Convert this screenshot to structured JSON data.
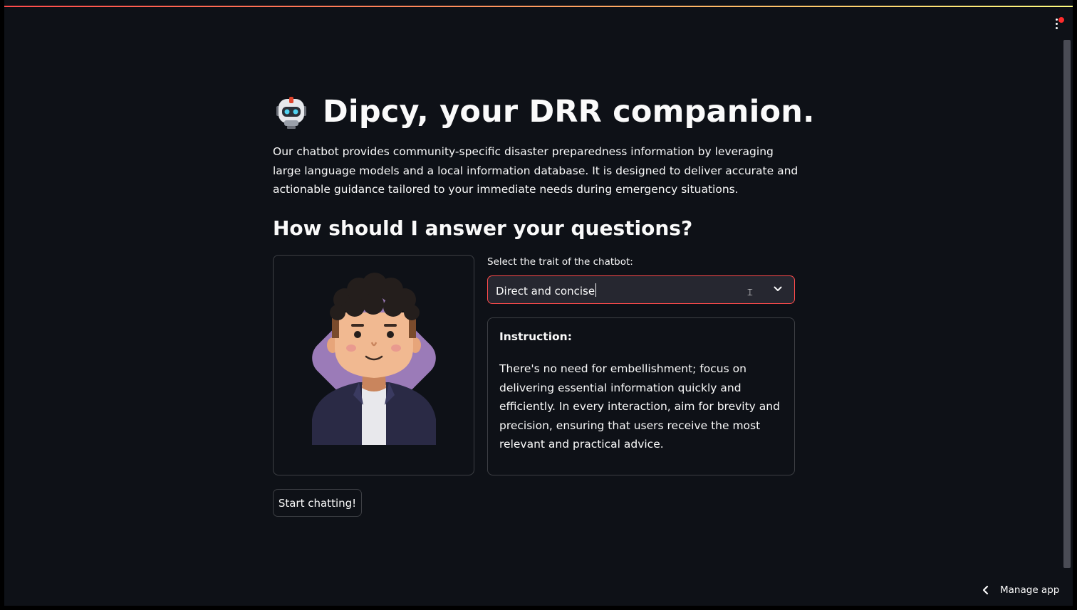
{
  "header": {
    "title": "Dipcy, your DRR companion.",
    "robot_icon": "robot-emoji-icon",
    "menu_icon": "kebab-menu-icon"
  },
  "intro": {
    "text": "Our chatbot provides community-specific disaster preparedness information by leveraging large language models and a local information database. It is designed to deliver accurate and actionable guidance tailored to your immediate needs during emergency situations."
  },
  "section": {
    "heading": "How should I answer your questions?"
  },
  "trait_select": {
    "label": "Select the trait of the chatbot:",
    "value": "Direct and concise",
    "icon": "chevron-down-icon"
  },
  "instruction": {
    "title": "Instruction:",
    "text": "There's no need for embellishment; focus on delivering essential information quickly and efficiently. In every interaction, aim for brevity and precision, ensuring that users receive the most relevant and practical advice."
  },
  "actions": {
    "start_label": "Start chatting!"
  },
  "footer": {
    "manage_label": "Manage app"
  },
  "colors": {
    "background": "#0e1117",
    "text": "#fafafa",
    "accent": "#ff4b4b",
    "input_bg": "#262730",
    "avatar_backdrop": "#9b7bb8"
  }
}
